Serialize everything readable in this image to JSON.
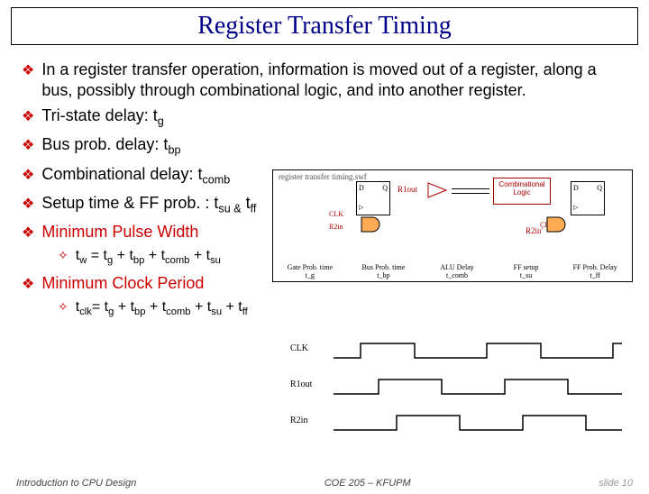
{
  "title": "Register Transfer Timing",
  "bullets": [
    "In a register transfer operation, information is moved out of a register, along a bus, possibly through combinational logic, and into another register.",
    "Tri-state delay: t<sub>g</sub>",
    "Bus prob. delay: t<sub>bp</sub>",
    "Combinational delay: t<sub>comb</sub>",
    "Setup time & FF prob. : t<sub>su &</sub> t<sub>ff</sub>"
  ],
  "red_bullets": [
    {
      "text": "Minimum Pulse Width",
      "sub": "t<sub>w</sub> = t<sub>g</sub> + t<sub>bp</sub> + t<sub>comb</sub> + t<sub>su</sub>"
    },
    {
      "text": "Minimum Clock Period",
      "sub": "t<sub>clk</sub>= t<sub>g</sub> + t<sub>bp</sub> + t<sub>comb</sub> + t<sub>su</sub> + t<sub>ff</sub>"
    }
  ],
  "diag1": {
    "placeholder": "register transfer timing.swf",
    "dq1": {
      "D": "D",
      "Q": "Q"
    },
    "dq2": {
      "D": "D",
      "Q": "Q"
    },
    "r1out": "R1out",
    "r2in": "R2in'",
    "clk": "CLK",
    "r2lbl": "R2in",
    "comb": "Combinational Logic",
    "bottom": [
      "Gate Prob. time",
      "Bus Prob. time",
      "ALU Delay",
      "FF setup",
      "FF Prob. Delay"
    ],
    "bvars": [
      "t_g",
      "t_bp",
      "t_comb",
      "t_su",
      "t_ff"
    ]
  },
  "diag2": {
    "rows": [
      "CLK",
      "R1out",
      "R2in"
    ]
  },
  "footer": {
    "left": "Introduction to CPU Design",
    "center": "COE 205 – KFUPM",
    "right": "slide 10"
  }
}
